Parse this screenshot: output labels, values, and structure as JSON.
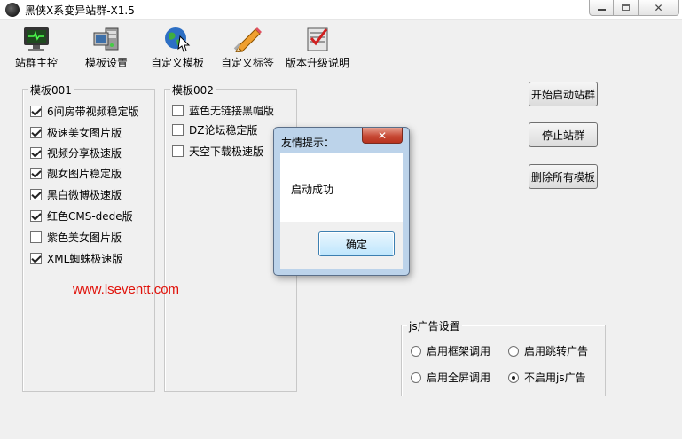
{
  "window": {
    "title": "黑侠X系变异站群-X1.5"
  },
  "toolbar": {
    "items": [
      {
        "label": "站群主控",
        "icon": "monitor-icon"
      },
      {
        "label": "模板设置",
        "icon": "template-settings-icon"
      },
      {
        "label": "自定义模板",
        "icon": "globe-cursor-icon"
      },
      {
        "label": "自定义标签",
        "icon": "pencil-icon"
      },
      {
        "label": "版本升级说明",
        "icon": "checklist-icon"
      }
    ]
  },
  "group1": {
    "legend": "模板001",
    "items": [
      {
        "label": "6间房带视频稳定版",
        "checked": true
      },
      {
        "label": "极速美女图片版",
        "checked": true
      },
      {
        "label": "视频分享极速版",
        "checked": true
      },
      {
        "label": "靓女图片稳定版",
        "checked": true
      },
      {
        "label": "黑白微博极速版",
        "checked": true
      },
      {
        "label": "红色CMS-dede版",
        "checked": true
      },
      {
        "label": "紫色美女图片版",
        "checked": false
      },
      {
        "label": "XML蜘蛛极速版",
        "checked": true
      }
    ]
  },
  "group2": {
    "legend": "模板002",
    "items": [
      {
        "label": "蓝色无链接黑帽版",
        "checked": false
      },
      {
        "label": "DZ论坛稳定版",
        "checked": false
      },
      {
        "label": "天空下载极速版",
        "checked": false
      }
    ]
  },
  "buttons": {
    "start": "开始启动站群",
    "stop": "停止站群",
    "delete_all": "删除所有模板"
  },
  "js_ads": {
    "legend": "js广告设置",
    "options": [
      {
        "label": "启用框架调用",
        "selected": false
      },
      {
        "label": "启用跳转广告",
        "selected": false
      },
      {
        "label": "启用全屏调用",
        "selected": false
      },
      {
        "label": "不启用js广告",
        "selected": true
      }
    ]
  },
  "watermark": "www.lseventt.com",
  "dialog": {
    "title": "友情提示：",
    "message": "启动成功",
    "ok_label": "确定"
  },
  "colors": {
    "watermark": "#e0120a",
    "dialog_frame": "#bcd3ea",
    "dialog_close": "#c74a36"
  }
}
